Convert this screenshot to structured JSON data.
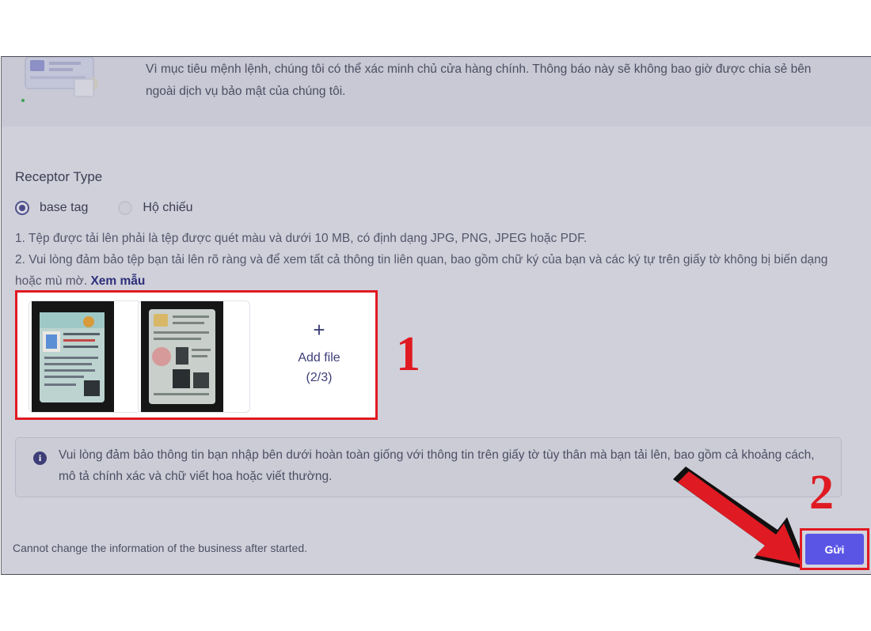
{
  "intro": {
    "text": "Vì mục tiêu mệnh lệnh, chúng tôi có thể xác minh chủ cửa hàng chính. Thông báo này sẽ không bao giờ được chia sẻ bên ngoài dịch vụ bảo mật của chúng tôi."
  },
  "receptor": {
    "title": "Receptor Type",
    "options": [
      {
        "label": "base tag",
        "selected": true
      },
      {
        "label": "Hộ chiếu",
        "selected": false
      }
    ]
  },
  "requirements": [
    "1. Tệp được tải lên phải là tệp được quét màu và dưới 10 MB, có định dạng JPG, PNG, JPEG hoặc PDF.",
    "2. Vui lòng đảm bảo tệp bạn tải lên rõ ràng và để xem tất cả thông tin liên quan, bao gồm chữ ký của bạn và các ký tự trên giấy tờ không bị biến dạng hoặc mù mờ."
  ],
  "sample_link": "Xem mẫu",
  "upload": {
    "add_label": "Add file",
    "count": "(2/3)",
    "plus": "+"
  },
  "info": {
    "text": "Vui lòng đảm bảo thông tin bạn nhập bên dưới hoàn toàn giống với thông tin trên giấy tờ tùy thân mà bạn tải lên, bao gồm cả khoảng cách, mô tả chính xác và chữ viết hoa hoặc viết thường.",
    "icon": "i"
  },
  "footer": {
    "note": "Cannot change the information of the business after started."
  },
  "submit": {
    "label": "Gửi"
  },
  "annotations": {
    "step1": "1",
    "step2": "2"
  },
  "colors": {
    "accent": "#5b55e6",
    "highlight": "#e01a22",
    "overlay": "#cfd0da"
  }
}
